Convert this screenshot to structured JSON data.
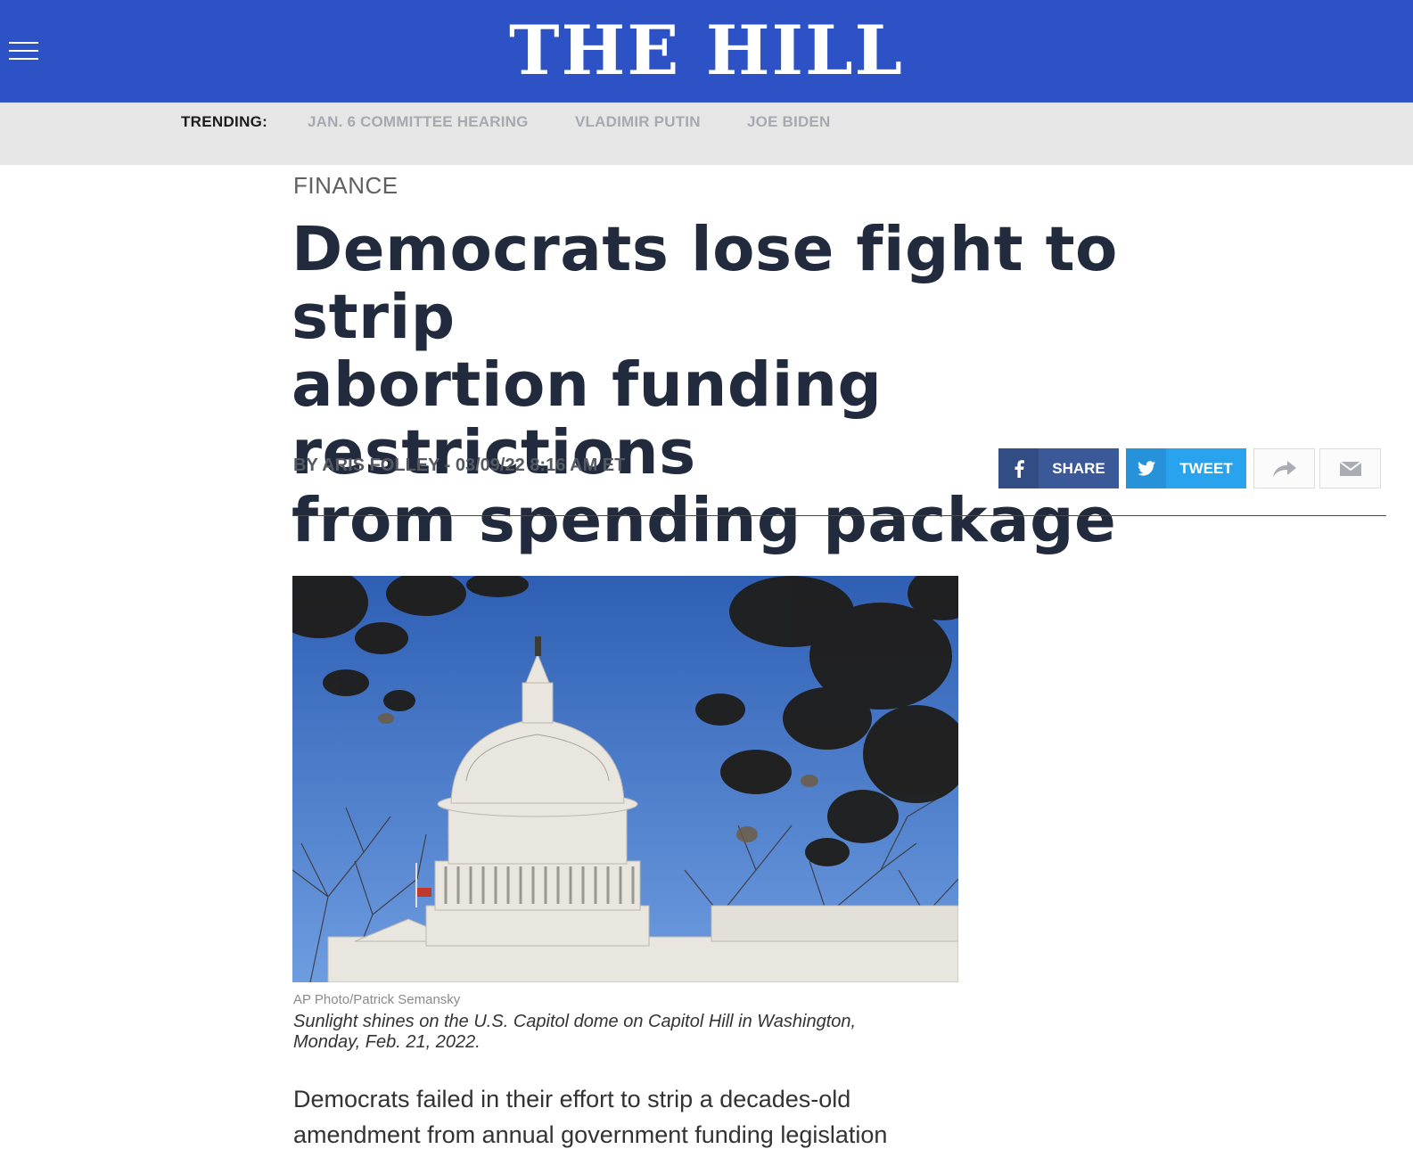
{
  "header": {
    "logo_text": "THE HILL",
    "brand_color": "#2c52c6"
  },
  "trending": {
    "label": "TRENDING:",
    "items": [
      "JAN. 6 COMMITTEE HEARING",
      "VLADIMIR PUTIN",
      "JOE BIDEN"
    ]
  },
  "article": {
    "section": "FINANCE",
    "headline_lines": [
      "Democrats lose fight to strip",
      "abortion funding restrictions",
      "from spending package"
    ],
    "byline": "BY ARIS FOLLEY - 03/09/22 8:16 AM ET",
    "photo_credit": "AP Photo/Patrick Semansky",
    "caption_lines": [
      "Sunlight shines on the U.S. Capitol dome on Capitol Hill in Washington,",
      "Monday, Feb. 21, 2022."
    ],
    "body_lines": [
      "Democrats failed in their effort to strip a decades-old",
      "amendment from annual government funding legislation"
    ]
  },
  "share": {
    "facebook_label": "SHARE",
    "facebook_icon": "facebook-icon",
    "twitter_label": "TWEET",
    "twitter_icon": "twitter-icon",
    "share_icon": "share-arrow-icon",
    "email_icon": "email-icon"
  }
}
